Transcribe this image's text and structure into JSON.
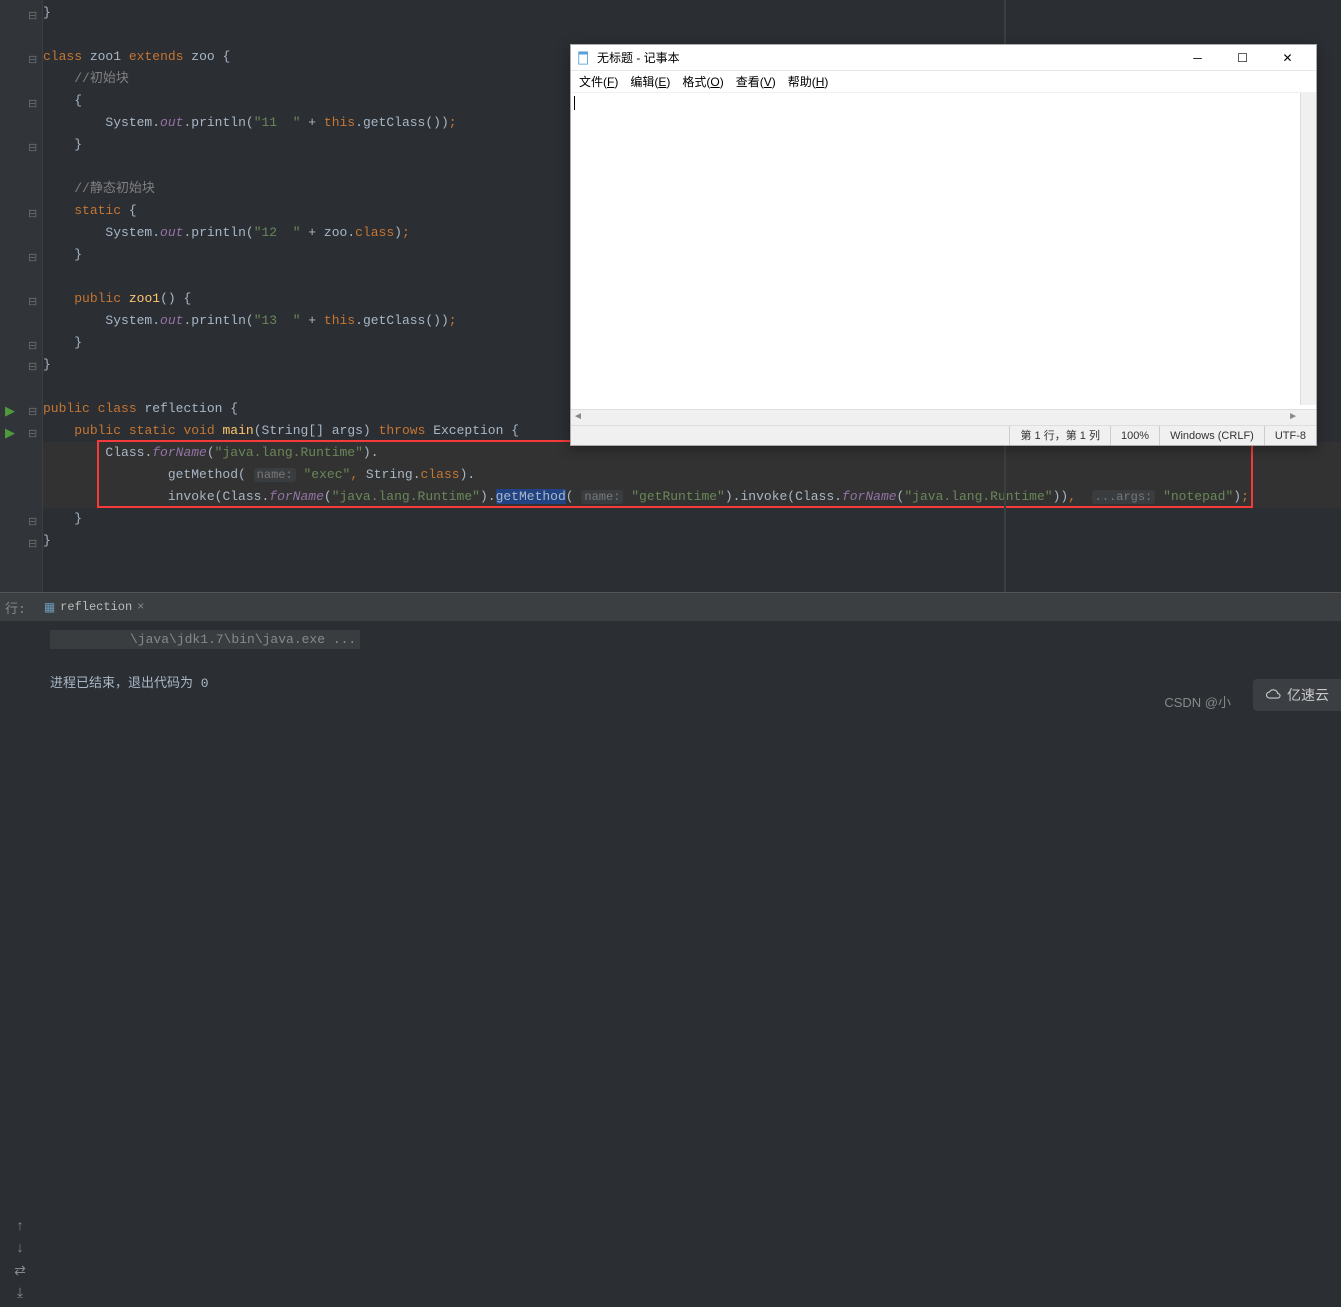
{
  "gutter": {
    "run_icons": [
      405,
      427
    ],
    "fold_lines": [
      9,
      53,
      97,
      141,
      207,
      251,
      295,
      339,
      360,
      405,
      427,
      515,
      537
    ]
  },
  "code": {
    "l1": "}",
    "cl_kw": "class",
    "cl_name": "zoo1",
    "ext_kw": "extends",
    "ext_name": "zoo",
    "l3_brace": " {",
    "cmt1": "//初始块",
    "brace_o": "{",
    "sys": "System",
    "dot": ".",
    "out": "out",
    "println": "println",
    "popen": "(",
    "s11": "\"11  \"",
    "plus": " + ",
    "this": "this",
    "getClass": "getClass",
    "pp": "()",
    "pc": ")",
    "semi": ";",
    "brace_c": "}",
    "cmt2": "//静态初始块",
    "static": "static",
    "s12": "\"12  \"",
    "zoo": "zoo",
    "class_kw": "class",
    "public": "public",
    "ctor": "zoo1",
    "s13": "\"13  \"",
    "refl_cls": "reflection",
    "void": "void",
    "main": "main",
    "args": "(String[] args)",
    "throws": "throws",
    "exc": "Exception",
    "Class": "Class",
    "forName": "forName",
    "jlr": "\"java.lang.Runtime\"",
    "getMethod": "getMethod",
    "hint_name": "name:",
    "exec": "\"exec\"",
    "comma": ", ",
    "String": "String",
    "invoke": "invoke",
    "getRuntime": "\"getRuntime\"",
    "hint_args": "...args:",
    "notepad": "\"notepad\""
  },
  "bottom": {
    "leftlabel": "行:",
    "tab_name": "reflection",
    "cmd_path": "\\java\\jdk1.7\\bin\\java.exe ...",
    "exit_msg": "进程已结束，退出代码为 0"
  },
  "notepad": {
    "title": "无标题 - 记事本",
    "menu": {
      "file": "文件(F)",
      "edit": "编辑(E)",
      "format": "格式(O)",
      "view": "查看(V)",
      "help": "帮助(H)"
    },
    "status": {
      "pos": "第 1 行，第 1 列",
      "zoom": "100%",
      "eol": "Windows (CRLF)",
      "enc": "UTF-8"
    }
  },
  "watermark": {
    "csdn": "CSDN @小",
    "yisu": "亿速云"
  }
}
